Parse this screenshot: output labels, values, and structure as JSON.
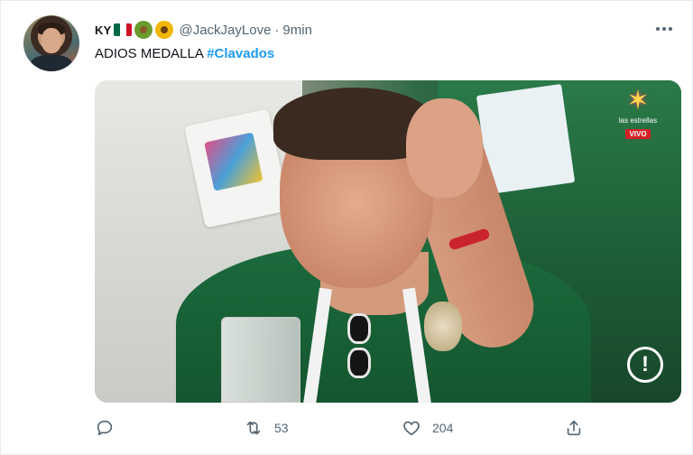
{
  "author": {
    "display_name": "KY",
    "emojis": [
      "mexico-flag",
      "avocado",
      "sunflower"
    ],
    "handle": "@JackJayLove",
    "separator": "·",
    "time": "9min"
  },
  "tweet": {
    "text": "ADIOS MEDALLA",
    "hashtag": "#Clavados"
  },
  "media": {
    "logo_text": "las estrellas",
    "live_badge": "VIVO",
    "info_glyph": "!"
  },
  "actions": {
    "reply_count": "",
    "retweet_count": "53",
    "like_count": "204"
  },
  "colors": {
    "hashtag": "#1d9bf0",
    "muted": "#536471",
    "text": "#0f1419",
    "flag_green": "#006847",
    "flag_white": "#ffffff",
    "flag_red": "#ce1126"
  },
  "icons": [
    "more-icon",
    "reply-icon",
    "retweet-icon",
    "like-icon",
    "share-icon",
    "info-icon",
    "las-estrellas-logo-icon"
  ]
}
